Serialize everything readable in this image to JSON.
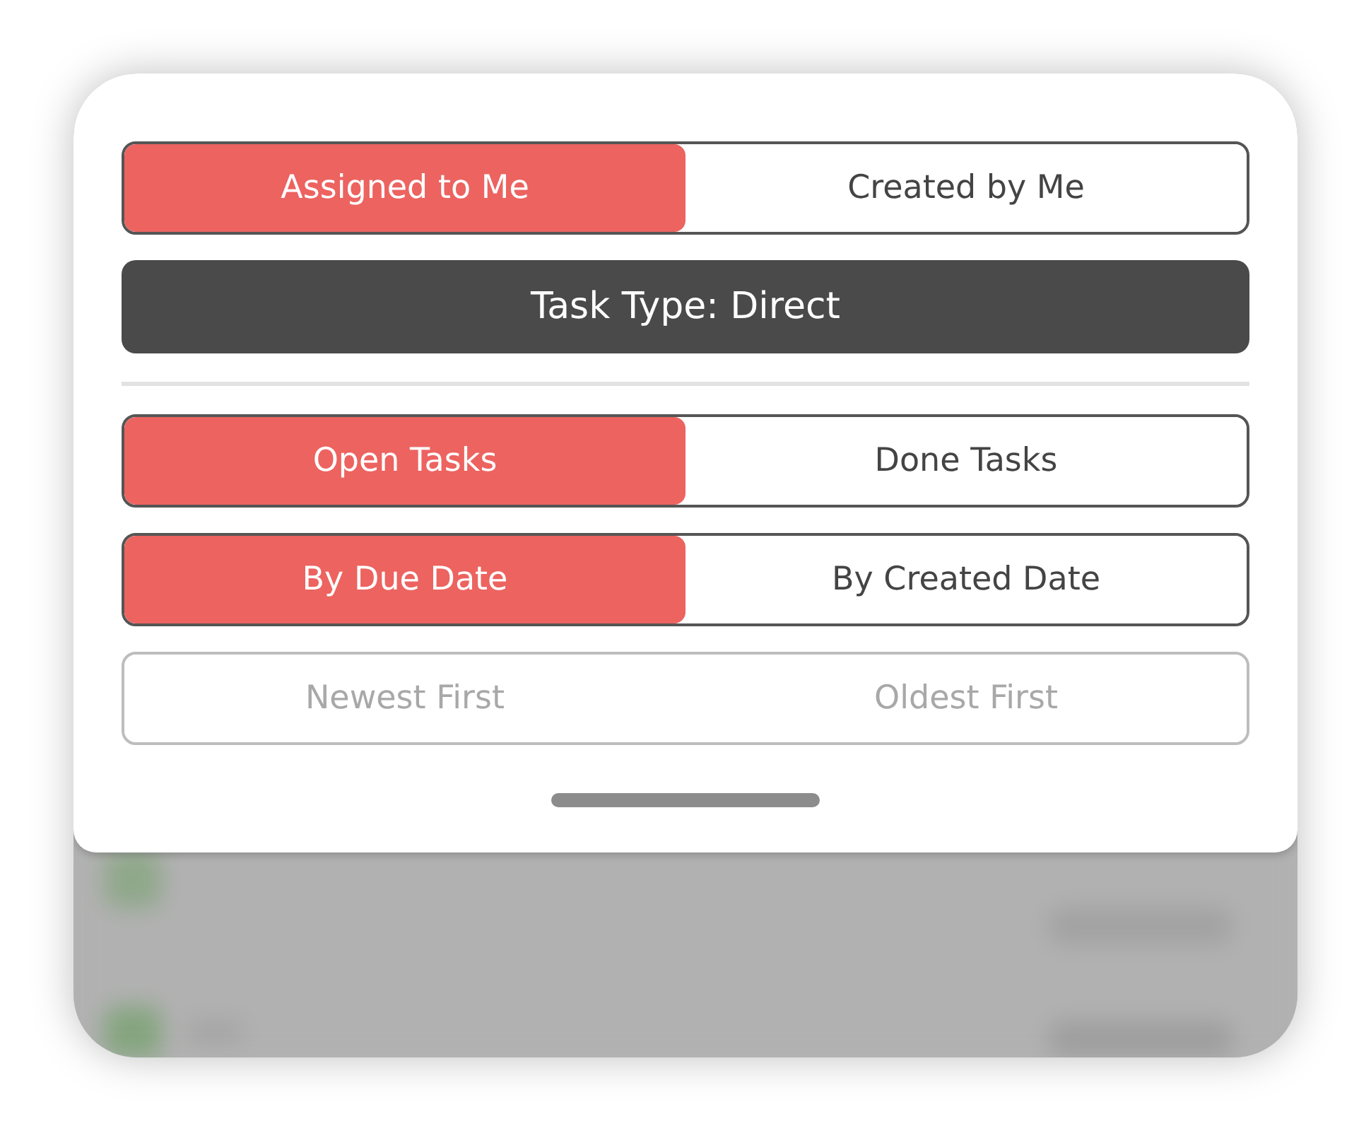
{
  "sheet": {
    "rows": [
      {
        "kind": "toggle",
        "disabled": false,
        "options": [
          {
            "label": "Assigned to Me",
            "selected": true
          },
          {
            "label": "Created by Me",
            "selected": false
          }
        ]
      },
      {
        "kind": "bar",
        "label": "Task Type: Direct"
      },
      {
        "kind": "divider"
      },
      {
        "kind": "toggle",
        "disabled": false,
        "options": [
          {
            "label": "Open Tasks",
            "selected": true
          },
          {
            "label": "Done Tasks",
            "selected": false
          }
        ]
      },
      {
        "kind": "toggle",
        "disabled": false,
        "options": [
          {
            "label": "By Due Date",
            "selected": true
          },
          {
            "label": "By Created Date",
            "selected": false
          }
        ]
      },
      {
        "kind": "toggle",
        "disabled": true,
        "options": [
          {
            "label": "Newest First",
            "selected": false
          },
          {
            "label": "Oldest First",
            "selected": false
          }
        ]
      }
    ]
  }
}
